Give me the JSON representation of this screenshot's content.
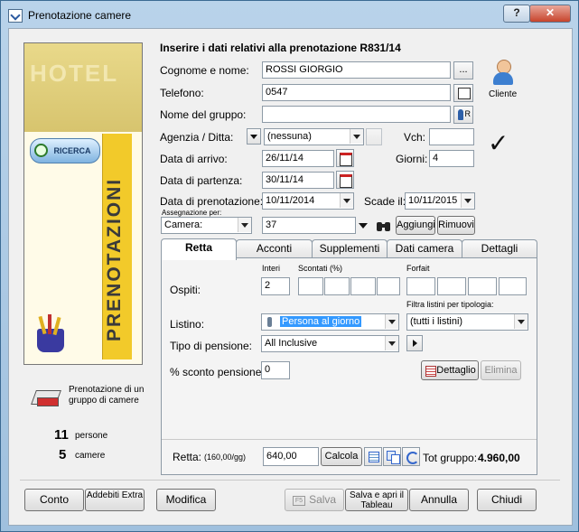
{
  "window": {
    "title": "Prenotazione camere"
  },
  "header": {
    "text": "Inserire i dati relativi alla prenotazione R831/14"
  },
  "form": {
    "cognome_label": "Cognome e nome:",
    "cognome_value": "ROSSI GIORGIO",
    "ellipsis": "...",
    "telefono_label": "Telefono:",
    "telefono_value": "0547",
    "gruppo_label": "Nome del gruppo:",
    "gruppo_value": "",
    "gruppo_btn_letter": "R",
    "agenzia_label": "Agenzia / Ditta:",
    "agenzia_value": "(nessuna)",
    "vch_label": "Vch:",
    "vch_value": "",
    "arrivo_label": "Data di arrivo:",
    "arrivo_value": "26/11/14",
    "giorni_label": "Giorni:",
    "giorni_value": "4",
    "partenza_label": "Data di partenza:",
    "partenza_value": "30/11/14",
    "prenotazione_label": "Data di prenotazione:",
    "prenotazione_value": "10/11/2014",
    "scade_label": "Scade il:",
    "scade_value": "10/11/2015",
    "assegnazione_label": "Assegnazione per:",
    "assegnazione_value": "Camera:",
    "camera_value": "37",
    "aggiungi": "Aggiungi",
    "rimuovi": "Rimuovi",
    "cliente_label": "Cliente"
  },
  "side": {
    "hotel_text": "HOTEL",
    "search_label": "RICERCA",
    "vertical_text": "PRENOTAZIONI",
    "group_text": "Prenotazione di un gruppo di camere",
    "persone_count": "11",
    "persone_label": "persone",
    "camere_count": "5",
    "camere_label": "camere"
  },
  "tabs": [
    {
      "label": "Retta",
      "active": true
    },
    {
      "label": "Acconti"
    },
    {
      "label": "Supplementi"
    },
    {
      "label": "Dati camera"
    },
    {
      "label": "Dettagli"
    }
  ],
  "retta": {
    "interi_label": "Interi",
    "scontati_label": "Scontati (%)",
    "forfait_label": "Forfait",
    "ospiti_label": "Ospiti:",
    "ospiti_interi": "2",
    "filtra_label": "Filtra listini per tipologia:",
    "listino_label": "Listino:",
    "listino_value": "Persona al giorno",
    "filtro_value": "(tutti i listini)",
    "pensione_label": "Tipo di pensione:",
    "pensione_value": "All Inclusive",
    "sconto_label": "% sconto pensione:",
    "sconto_value": "0",
    "dettaglio": "Dettaglio",
    "elimina": "Elimina",
    "retta_label": "Retta:",
    "retta_per_day": "(160,00/gg)",
    "retta_value": "640,00",
    "calcola": "Calcola",
    "tot_label": "Tot gruppo:",
    "tot_value": "4.960,00"
  },
  "footer": {
    "conto": "Conto",
    "addebiti": "Addebiti Extra",
    "modifica": "Modifica",
    "f5": "F5",
    "salva": "Salva",
    "salva_apri": "Salva e apri il Tableau",
    "annulla": "Annulla",
    "chiudi": "Chiudi"
  },
  "colors": {
    "title_bar": "#b9d3ea",
    "close": "#c7442c",
    "highlight": "#3399ff"
  }
}
